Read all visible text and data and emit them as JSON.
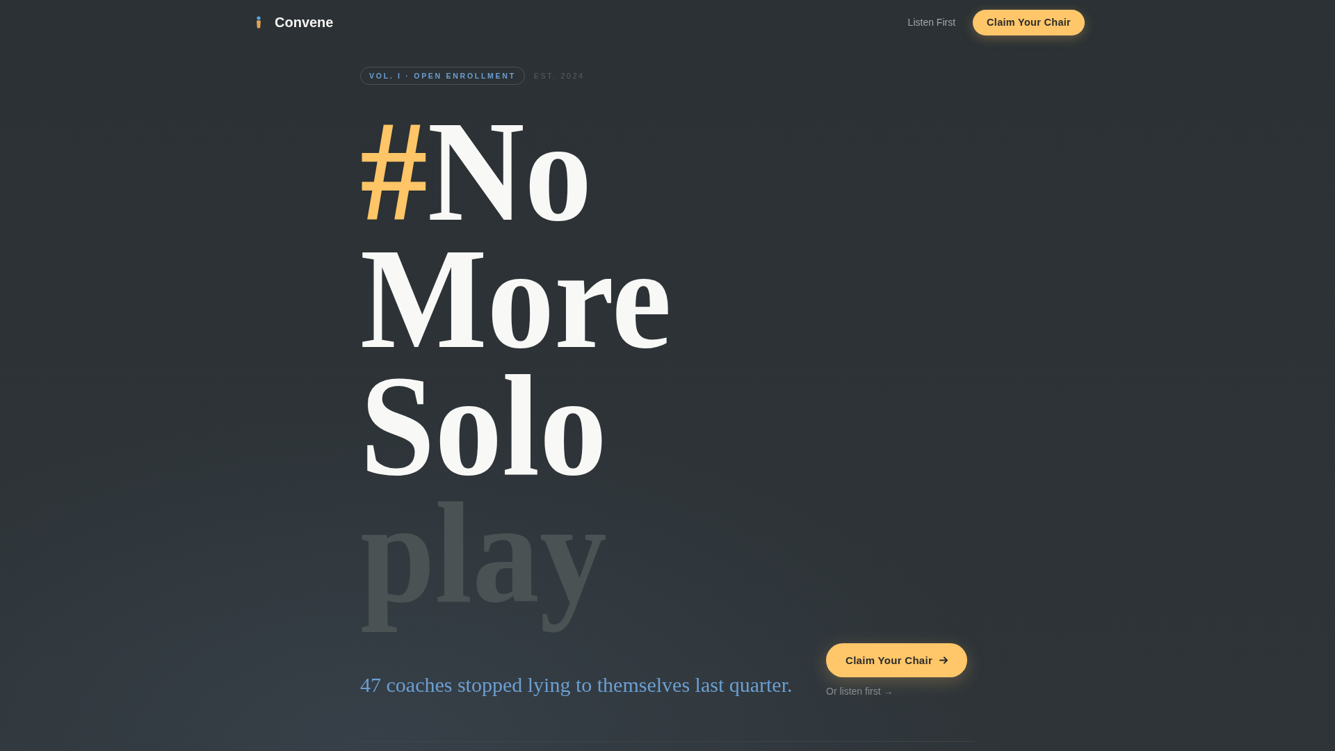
{
  "nav": {
    "brand": "Convene",
    "links": [
      {
        "label": "Listen First"
      }
    ],
    "cta": "Claim Your Chair"
  },
  "hero": {
    "badge": "VOL. I · OPEN ENROLLMENT",
    "established": "EST. 2024",
    "headline": {
      "lines": [
        {
          "segments": [
            {
              "text": "#",
              "kind": "accent"
            },
            {
              "text": "No",
              "kind": "plain"
            }
          ]
        },
        {
          "segments": [
            {
              "text": "More",
              "kind": "plain"
            }
          ]
        },
        {
          "segments": [
            {
              "text": "Solo",
              "kind": "plain"
            }
          ]
        },
        {
          "segments": [
            {
              "text": "play",
              "kind": "faded"
            }
          ]
        }
      ]
    },
    "subtitle": "47 coaches stopped lying to themselves last quarter.",
    "cta": "Claim Your Chair",
    "secondary_link": "Or listen first →"
  }
}
